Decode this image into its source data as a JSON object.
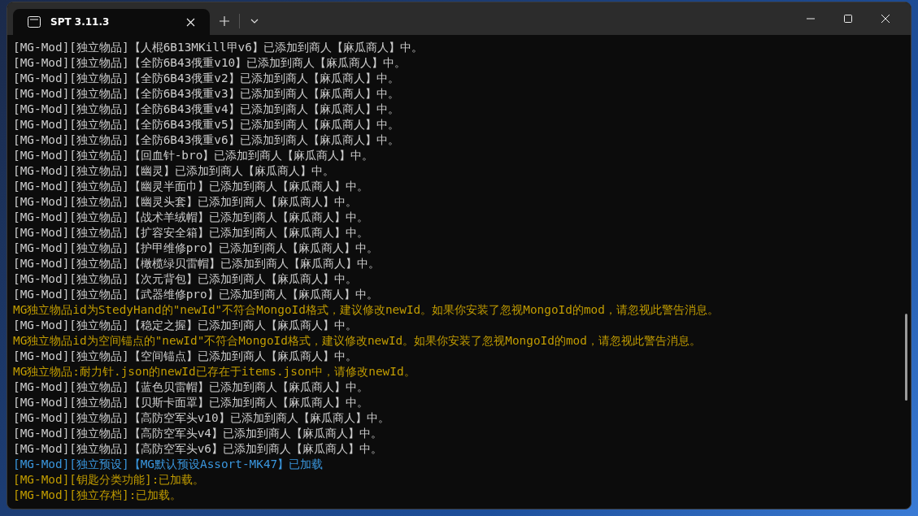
{
  "window": {
    "tabs": [
      {
        "title": "SPT 3.11.3",
        "selected": true
      }
    ]
  },
  "console": {
    "lines": [
      {
        "text": "[MG-Mod][独立物品]【人棍6B13MKill甲v6】已添加到商人【麻瓜商人】中。",
        "color": "#cccccc"
      },
      {
        "text": "[MG-Mod][独立物品]【全防6B43俄重v10】已添加到商人【麻瓜商人】中。",
        "color": "#cccccc"
      },
      {
        "text": "[MG-Mod][独立物品]【全防6B43俄重v2】已添加到商人【麻瓜商人】中。",
        "color": "#cccccc"
      },
      {
        "text": "[MG-Mod][独立物品]【全防6B43俄重v3】已添加到商人【麻瓜商人】中。",
        "color": "#cccccc"
      },
      {
        "text": "[MG-Mod][独立物品]【全防6B43俄重v4】已添加到商人【麻瓜商人】中。",
        "color": "#cccccc"
      },
      {
        "text": "[MG-Mod][独立物品]【全防6B43俄重v5】已添加到商人【麻瓜商人】中。",
        "color": "#cccccc"
      },
      {
        "text": "[MG-Mod][独立物品]【全防6B43俄重v6】已添加到商人【麻瓜商人】中。",
        "color": "#cccccc"
      },
      {
        "text": "[MG-Mod][独立物品]【回血针-bro】已添加到商人【麻瓜商人】中。",
        "color": "#cccccc"
      },
      {
        "text": "[MG-Mod][独立物品]【幽灵】已添加到商人【麻瓜商人】中。",
        "color": "#cccccc"
      },
      {
        "text": "[MG-Mod][独立物品]【幽灵半面巾】已添加到商人【麻瓜商人】中。",
        "color": "#cccccc"
      },
      {
        "text": "[MG-Mod][独立物品]【幽灵头套】已添加到商人【麻瓜商人】中。",
        "color": "#cccccc"
      },
      {
        "text": "[MG-Mod][独立物品]【战术羊绒帽】已添加到商人【麻瓜商人】中。",
        "color": "#cccccc"
      },
      {
        "text": "[MG-Mod][独立物品]【扩容安全箱】已添加到商人【麻瓜商人】中。",
        "color": "#cccccc"
      },
      {
        "text": "[MG-Mod][独立物品]【护甲维修pro】已添加到商人【麻瓜商人】中。",
        "color": "#cccccc"
      },
      {
        "text": "[MG-Mod][独立物品]【橄榄绿贝雷帽】已添加到商人【麻瓜商人】中。",
        "color": "#cccccc"
      },
      {
        "text": "[MG-Mod][独立物品]【次元背包】已添加到商人【麻瓜商人】中。",
        "color": "#cccccc"
      },
      {
        "text": "[MG-Mod][独立物品]【武器维修pro】已添加到商人【麻瓜商人】中。",
        "color": "#cccccc"
      },
      {
        "text": "MG独立物品id为StedyHand的\"newId\"不符合MongoId格式，建议修改newId。如果你安装了忽视MongoId的mod，请忽视此警告消息。",
        "color": "#c19c00"
      },
      {
        "text": "[MG-Mod][独立物品]【稳定之握】已添加到商人【麻瓜商人】中。",
        "color": "#cccccc"
      },
      {
        "text": "MG独立物品id为空间锚点的\"newId\"不符合MongoId格式，建议修改newId。如果你安装了忽视MongoId的mod，请忽视此警告消息。",
        "color": "#c19c00"
      },
      {
        "text": "[MG-Mod][独立物品]【空间锚点】已添加到商人【麻瓜商人】中。",
        "color": "#cccccc"
      },
      {
        "text": "MG独立物品:耐力针.json的newId已存在于items.json中，请修改newId。",
        "color": "#c19c00"
      },
      {
        "text": "[MG-Mod][独立物品]【蓝色贝雷帽】已添加到商人【麻瓜商人】中。",
        "color": "#cccccc"
      },
      {
        "text": "[MG-Mod][独立物品]【贝斯卡面罩】已添加到商人【麻瓜商人】中。",
        "color": "#cccccc"
      },
      {
        "text": "[MG-Mod][独立物品]【高防空军头v10】已添加到商人【麻瓜商人】中。",
        "color": "#cccccc"
      },
      {
        "text": "[MG-Mod][独立物品]【高防空军头v4】已添加到商人【麻瓜商人】中。",
        "color": "#cccccc"
      },
      {
        "text": "[MG-Mod][独立物品]【高防空军头v6】已添加到商人【麻瓜商人】中。",
        "color": "#cccccc"
      },
      {
        "text": "[MG-Mod][独立预设]【MG默认预设Assort-MK47】已加载",
        "color": "#3a96dd"
      },
      {
        "text": "[MG-Mod][钥匙分类功能]:已加载。",
        "color": "#c19c00"
      },
      {
        "text": "[MG-Mod][独立存档]:已加载。",
        "color": "#c19c00"
      }
    ]
  }
}
